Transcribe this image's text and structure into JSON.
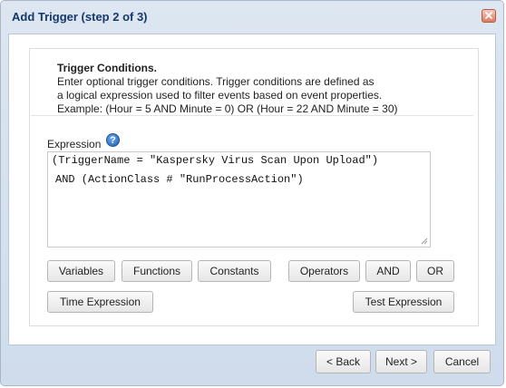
{
  "dialog": {
    "title": "Add Trigger (step 2 of 3)"
  },
  "info": {
    "heading": "Trigger Conditions.",
    "lines": [
      "Enter optional trigger conditions. Trigger conditions are defined as",
      "a logical expression used to filter events based on event properties.",
      "Example: (Hour = 5 AND Minute = 0) OR (Hour = 22 AND Minute = 30)"
    ]
  },
  "expression": {
    "label": "Expression",
    "help_icon": "?",
    "lines": [
      "(TriggerName = \"Kaspersky Virus Scan Upon Upload\")",
      "AND (ActionClass # \"RunProcessAction\")"
    ]
  },
  "buttons": {
    "variables": "Variables",
    "functions": "Functions",
    "constants": "Constants",
    "operators": "Operators",
    "and": "AND",
    "or": "OR",
    "time_expression": "Time Expression",
    "test_expression": "Test Expression"
  },
  "footer": {
    "back": "< Back",
    "next": "Next >",
    "cancel": "Cancel"
  },
  "colors": {
    "title_text": "#15386a",
    "dialog_bg": "#d6e1ee",
    "close_button": "#e07a5f",
    "help_icon": "#1f5fb5"
  }
}
